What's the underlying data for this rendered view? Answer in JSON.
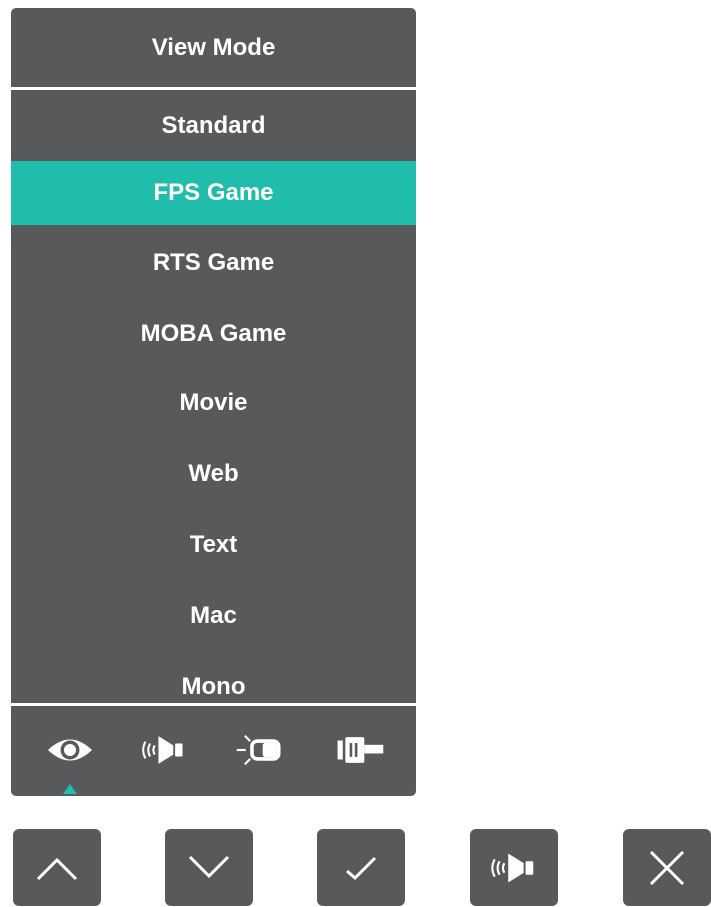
{
  "osd": {
    "title": "View Mode",
    "items": [
      {
        "label": "Standard",
        "selected": false
      },
      {
        "label": "FPS Game",
        "selected": true
      },
      {
        "label": "RTS Game",
        "selected": false
      },
      {
        "label": "MOBA Game",
        "selected": false
      },
      {
        "label": "Movie",
        "selected": false
      },
      {
        "label": "Web",
        "selected": false
      },
      {
        "label": "Text",
        "selected": false
      },
      {
        "label": "Mac",
        "selected": false
      },
      {
        "label": "Mono",
        "selected": false
      }
    ],
    "toolbar": [
      {
        "icon": "eye-icon",
        "active": true
      },
      {
        "icon": "speaker-icon",
        "active": false
      },
      {
        "icon": "brightness-icon",
        "active": false
      },
      {
        "icon": "input-source-icon",
        "active": false
      }
    ]
  },
  "hardware_buttons": [
    {
      "icon": "chevron-up-icon",
      "name": "up-button"
    },
    {
      "icon": "chevron-down-icon",
      "name": "down-button"
    },
    {
      "icon": "checkmark-icon",
      "name": "confirm-button"
    },
    {
      "icon": "speaker-icon",
      "name": "audio-button"
    },
    {
      "icon": "close-icon",
      "name": "exit-button"
    }
  ],
  "colors": {
    "panel": "#58595b",
    "accent": "#20bdac",
    "text": "#ffffff"
  }
}
